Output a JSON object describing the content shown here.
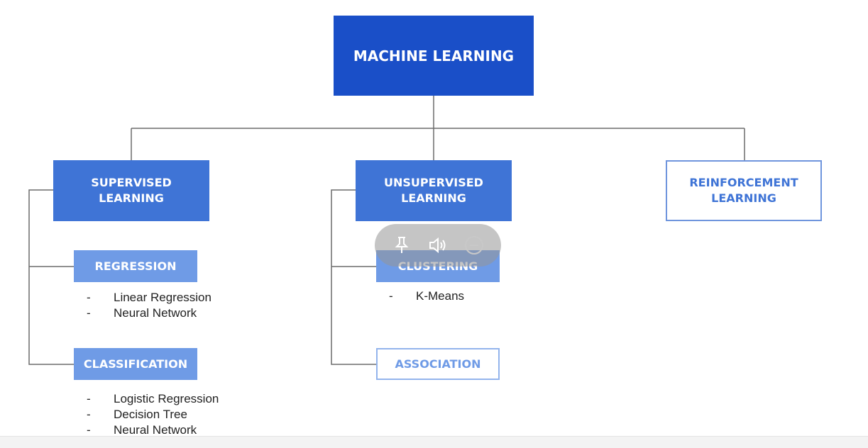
{
  "diagram": {
    "root": "MACHINE LEARNING",
    "categories": [
      {
        "label": "SUPERVISED\nLEARNING",
        "children": [
          {
            "label": "REGRESSION",
            "items": [
              "Linear Regression",
              "Neural Network"
            ]
          },
          {
            "label": "CLASSIFICATION",
            "items": [
              "Logistic Regression",
              "Decision Tree",
              "Neural Network"
            ]
          }
        ]
      },
      {
        "label": "UNSUPERVISED\nLEARNING",
        "children": [
          {
            "label": "CLUSTERING",
            "items": [
              "K-Means"
            ]
          },
          {
            "label": "ASSOCIATION",
            "items": []
          }
        ]
      },
      {
        "label": "REINFORCEMENT\nLEARNING",
        "children": []
      }
    ],
    "bullet": "-"
  },
  "overlay_toolbar": {
    "icons": [
      "pin-icon",
      "speaker-icon",
      "minus-circle-icon"
    ]
  },
  "colors": {
    "root": "#1a4fc8",
    "level1": "#3f74d6",
    "level2": "#6f9be6",
    "connector": "#6b6b6b"
  }
}
